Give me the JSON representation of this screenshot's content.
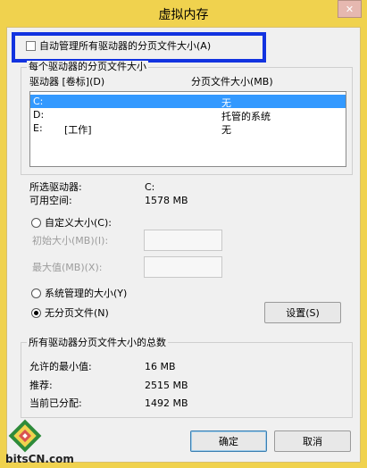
{
  "window": {
    "title": "虚拟内存",
    "close_label": "✕"
  },
  "auto_manage": {
    "label": "自动管理所有驱动器的分页文件大小(A)",
    "checked": false
  },
  "drive_group": {
    "title": "每个驱动器的分页文件大小",
    "col_drive": "驱动器 [卷标](D)",
    "col_size": "分页文件大小(MB)",
    "rows": [
      {
        "drive": "C:",
        "label": "",
        "size": "无"
      },
      {
        "drive": "D:",
        "label": "",
        "size": "托管的系统"
      },
      {
        "drive": "E:",
        "label": "[工作]",
        "size": "无"
      }
    ]
  },
  "selected": {
    "drive_label": "所选驱动器:",
    "drive_value": "C:",
    "space_label": "可用空间:",
    "space_value": "1578 MB"
  },
  "options": {
    "custom_label": "自定义大小(C):",
    "initial_label": "初始大小(MB)(I):",
    "max_label": "最大值(MB)(X):",
    "system_label": "系统管理的大小(Y)",
    "none_label": "无分页文件(N)",
    "set_button": "设置(S)"
  },
  "totals": {
    "title": "所有驱动器分页文件大小的总数",
    "min_label": "允许的最小值:",
    "min_value": "16 MB",
    "rec_label": "推荐:",
    "rec_value": "2515 MB",
    "cur_label": "当前已分配:",
    "cur_value": "1492 MB"
  },
  "buttons": {
    "ok": "确定",
    "cancel": "取消"
  },
  "logo": {
    "text": "bitsCN.com"
  }
}
